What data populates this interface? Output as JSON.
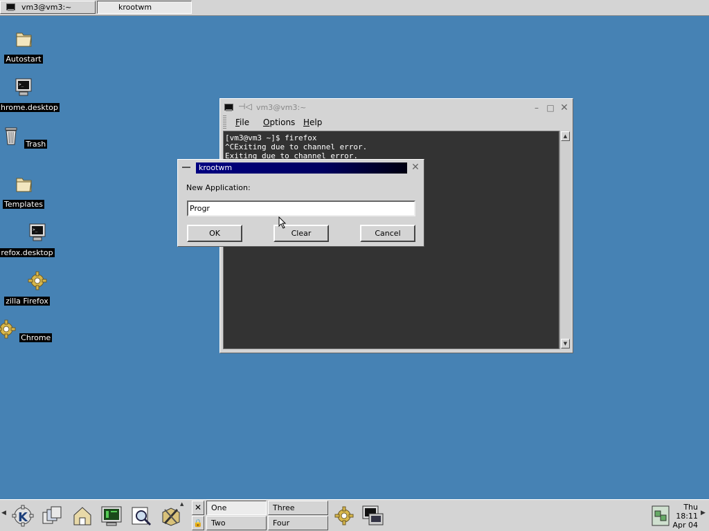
{
  "top_taskbar": {
    "tasks": [
      {
        "label": "vm3@vm3:~",
        "active": false
      },
      {
        "label": "krootwm",
        "active": true
      }
    ]
  },
  "desktop": {
    "icons": [
      {
        "label": "Autostart",
        "icon": "folder-icon"
      },
      {
        "label": "e-chrome.desktop",
        "icon": "terminal-icon"
      },
      {
        "label": "Trash",
        "icon": "trash-icon"
      },
      {
        "label": "Templates",
        "icon": "folder-icon"
      },
      {
        "label": "refox.desktop",
        "icon": "terminal-icon"
      },
      {
        "label": "zilla Firefox",
        "icon": "gear-icon"
      },
      {
        "label": "Chrome",
        "icon": "gear-icon"
      }
    ]
  },
  "terminal_window": {
    "title": "vm3@vm3:~",
    "menu": [
      {
        "label": "File",
        "accel": "F",
        "rest": "ile"
      },
      {
        "label": "Options",
        "accel": "O",
        "rest": "ptions"
      },
      {
        "label": "Help",
        "accel": "H",
        "rest": "elp"
      }
    ],
    "lines": [
      "[vm3@vm3 ~]$ firefox",
      "^CExiting due to channel error.",
      "Exiting due to channel error."
    ]
  },
  "dialog": {
    "title": "krootwm",
    "prompt": "New Application:",
    "input_value": "Progr",
    "ok_label": "OK",
    "clear_label": "Clear",
    "cancel_label": "Cancel"
  },
  "bottom_panel": {
    "desktops": [
      {
        "label": "One",
        "active": true
      },
      {
        "label": "Two",
        "active": false
      },
      {
        "label": "Three",
        "active": false
      },
      {
        "label": "Four",
        "active": false
      }
    ],
    "clock": {
      "day": "Thu",
      "time": "18:11",
      "date": "Apr 04"
    }
  },
  "colors": {
    "desktop_bg": "#4682b4",
    "titlebar_active": "#000080",
    "panel_bg": "#d4d4d4",
    "terminal_bg": "#333333"
  }
}
